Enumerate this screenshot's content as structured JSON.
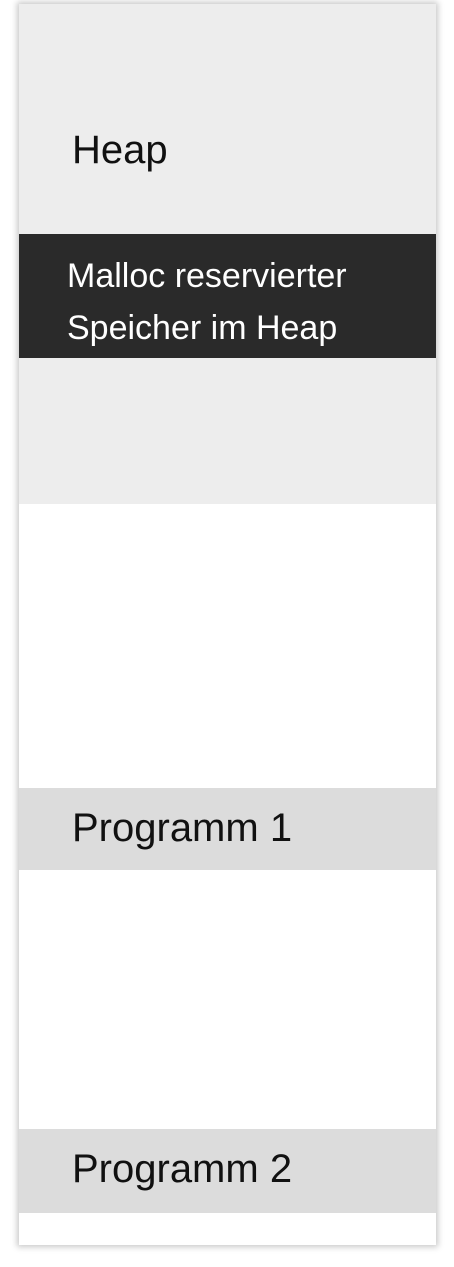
{
  "memory": {
    "heap_label": "Heap",
    "malloc_label": "Malloc reservierter Speicher im Heap",
    "programs": [
      {
        "label": "Programm 1"
      },
      {
        "label": "Programm 2"
      }
    ]
  },
  "colors": {
    "heap_fill": "#ededed",
    "malloc_fill": "#2a2a2a",
    "program_fill": "#dcdcdc",
    "free_fill": "#ffffff"
  }
}
